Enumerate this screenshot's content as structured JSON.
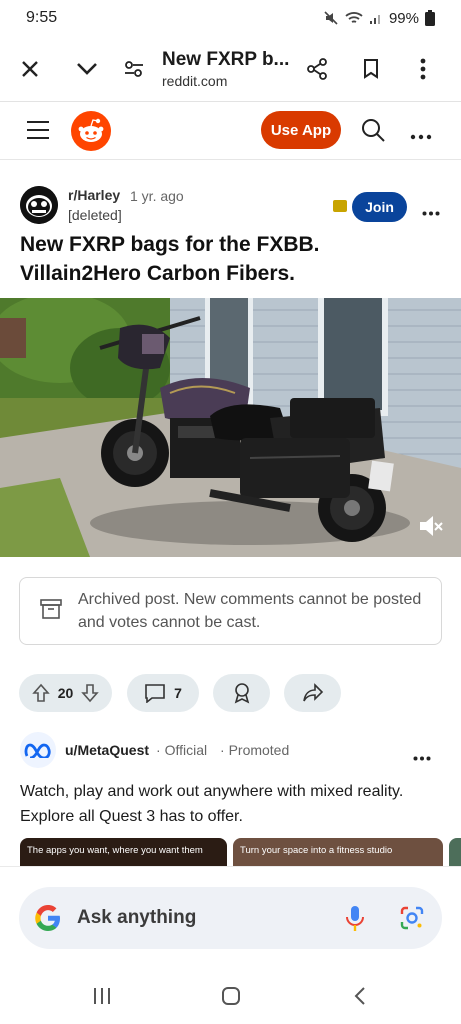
{
  "status_bar": {
    "time": "9:55",
    "battery": "99%"
  },
  "browser": {
    "title": "New FXRP b...",
    "url": "reddit.com"
  },
  "reddit_header": {
    "use_app_label": "Use App"
  },
  "post": {
    "subreddit": "r/Harley",
    "age": "1 yr. ago",
    "author": "[deleted]",
    "join_label": "Join",
    "title": "New FXRP bags for the FXBB. Villain2Hero Carbon Fibers.",
    "archive_notice": "Archived post. New comments cannot be posted and votes cannot be cast.",
    "votes": "20",
    "comments": "7"
  },
  "ad": {
    "advertiser": "u/MetaQuest",
    "official": "Official",
    "promoted": "Promoted",
    "body": "Watch, play and work out anywhere with mixed reality. Explore all Quest 3 has to offer.",
    "cards": [
      {
        "caption": "The apps you want, where you want them"
      },
      {
        "caption": "Turn your space into a fitness studio"
      }
    ]
  },
  "google": {
    "placeholder": "Ask anything"
  },
  "colors": {
    "accent": "#d93a00",
    "join": "#0a449b",
    "pill": "#e5ebee"
  }
}
